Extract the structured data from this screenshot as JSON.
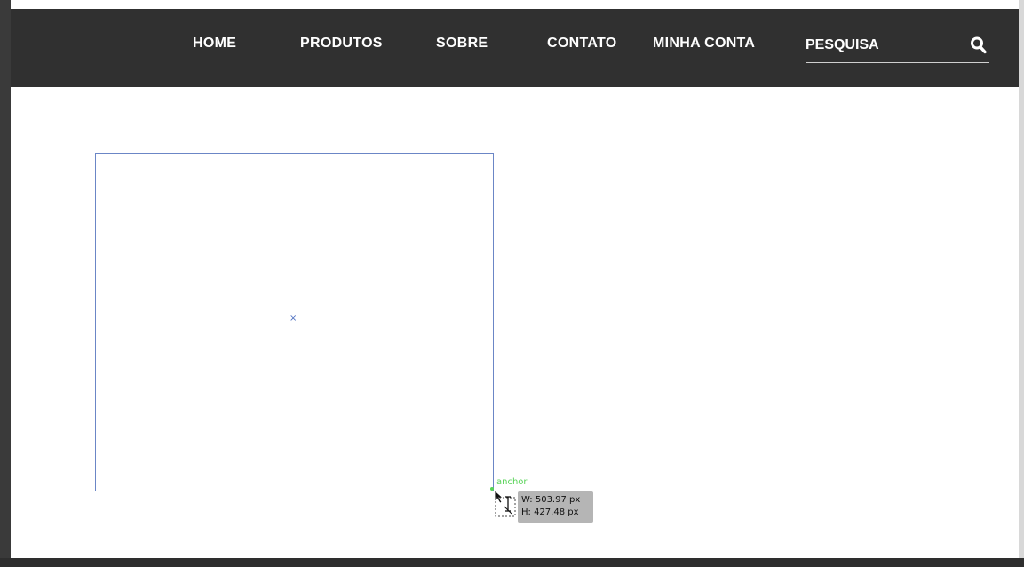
{
  "nav": {
    "items": [
      {
        "label": "HOME"
      },
      {
        "label": "PRODUTOS"
      },
      {
        "label": "SOBRE"
      },
      {
        "label": "CONTATO"
      },
      {
        "label": "MINHA CONTA"
      }
    ],
    "search": {
      "placeholder": "PESQUISA",
      "icon": "search-icon"
    }
  },
  "canvas": {
    "center_marker": "×",
    "anchor_label": "anchor",
    "size_tooltip": {
      "width_text": "W: 503.97 px",
      "height_text": "H: 427.48 px"
    }
  },
  "colors": {
    "navbar_bg": "#303030",
    "selection_stroke": "#6b86c6",
    "anchor_green": "#57d357",
    "tooltip_bg": "#b5b5b5"
  }
}
